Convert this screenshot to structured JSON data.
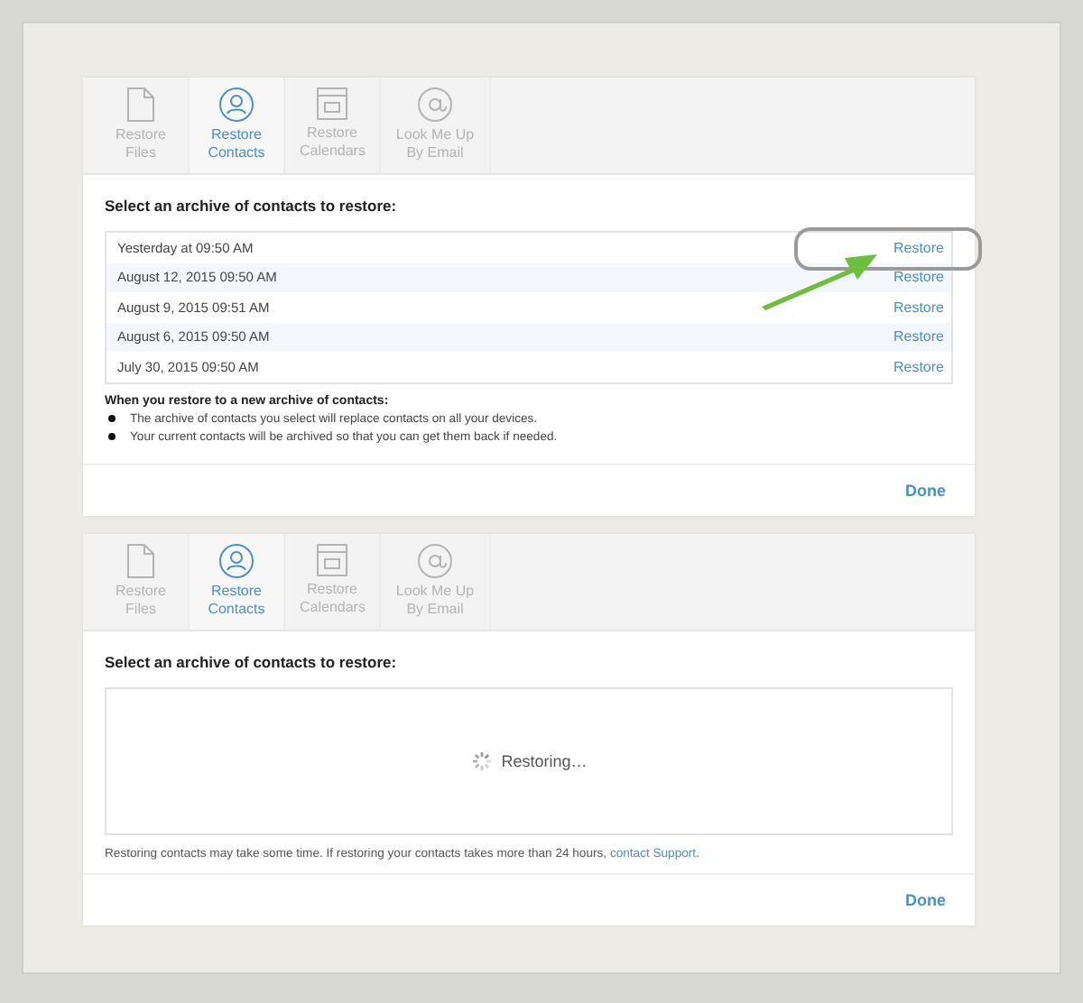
{
  "panels": [
    {
      "kind": "archive_list",
      "tabs": [
        {
          "label": "Restore Files",
          "selected": false
        },
        {
          "label": "Restore Contacts",
          "selected": true
        },
        {
          "label": "Restore Calendars",
          "selected": false
        },
        {
          "label": "Look Me Up By Email",
          "selected": false
        }
      ],
      "heading": "Select an archive of contacts to restore:",
      "rows": [
        {
          "date": "Yesterday at 09:50 AM",
          "action": "Restore",
          "highlighted": true
        },
        {
          "date": "August 12, 2015 09:50 AM",
          "action": "Restore",
          "highlighted": false
        },
        {
          "date": "August 9, 2015 09:51 AM",
          "action": "Restore",
          "highlighted": false
        },
        {
          "date": "August 6, 2015 09:50 AM",
          "action": "Restore",
          "highlighted": false
        },
        {
          "date": "July 30, 2015 09:50 AM",
          "action": "Restore",
          "highlighted": false
        }
      ],
      "notes_title": "When you restore to a new archive of contacts:",
      "notes": [
        "The archive of contacts you select will replace contacts on all your devices.",
        "Your current contacts will be archived so that you can get them back if needed."
      ],
      "done": "Done"
    },
    {
      "kind": "restoring",
      "tabs": [
        {
          "label": "Restore Files",
          "selected": false
        },
        {
          "label": "Restore Contacts",
          "selected": true
        },
        {
          "label": "Restore Calendars",
          "selected": false
        },
        {
          "label": "Look Me Up By Email",
          "selected": false
        }
      ],
      "heading": "Select an archive of contacts to restore:",
      "status": "Restoring…",
      "footer": {
        "text": "Restoring contacts may take some time. If restoring your contacts takes more than 24 hours,",
        "link": "contact Support",
        "end": "."
      },
      "done": "Done"
    }
  ]
}
